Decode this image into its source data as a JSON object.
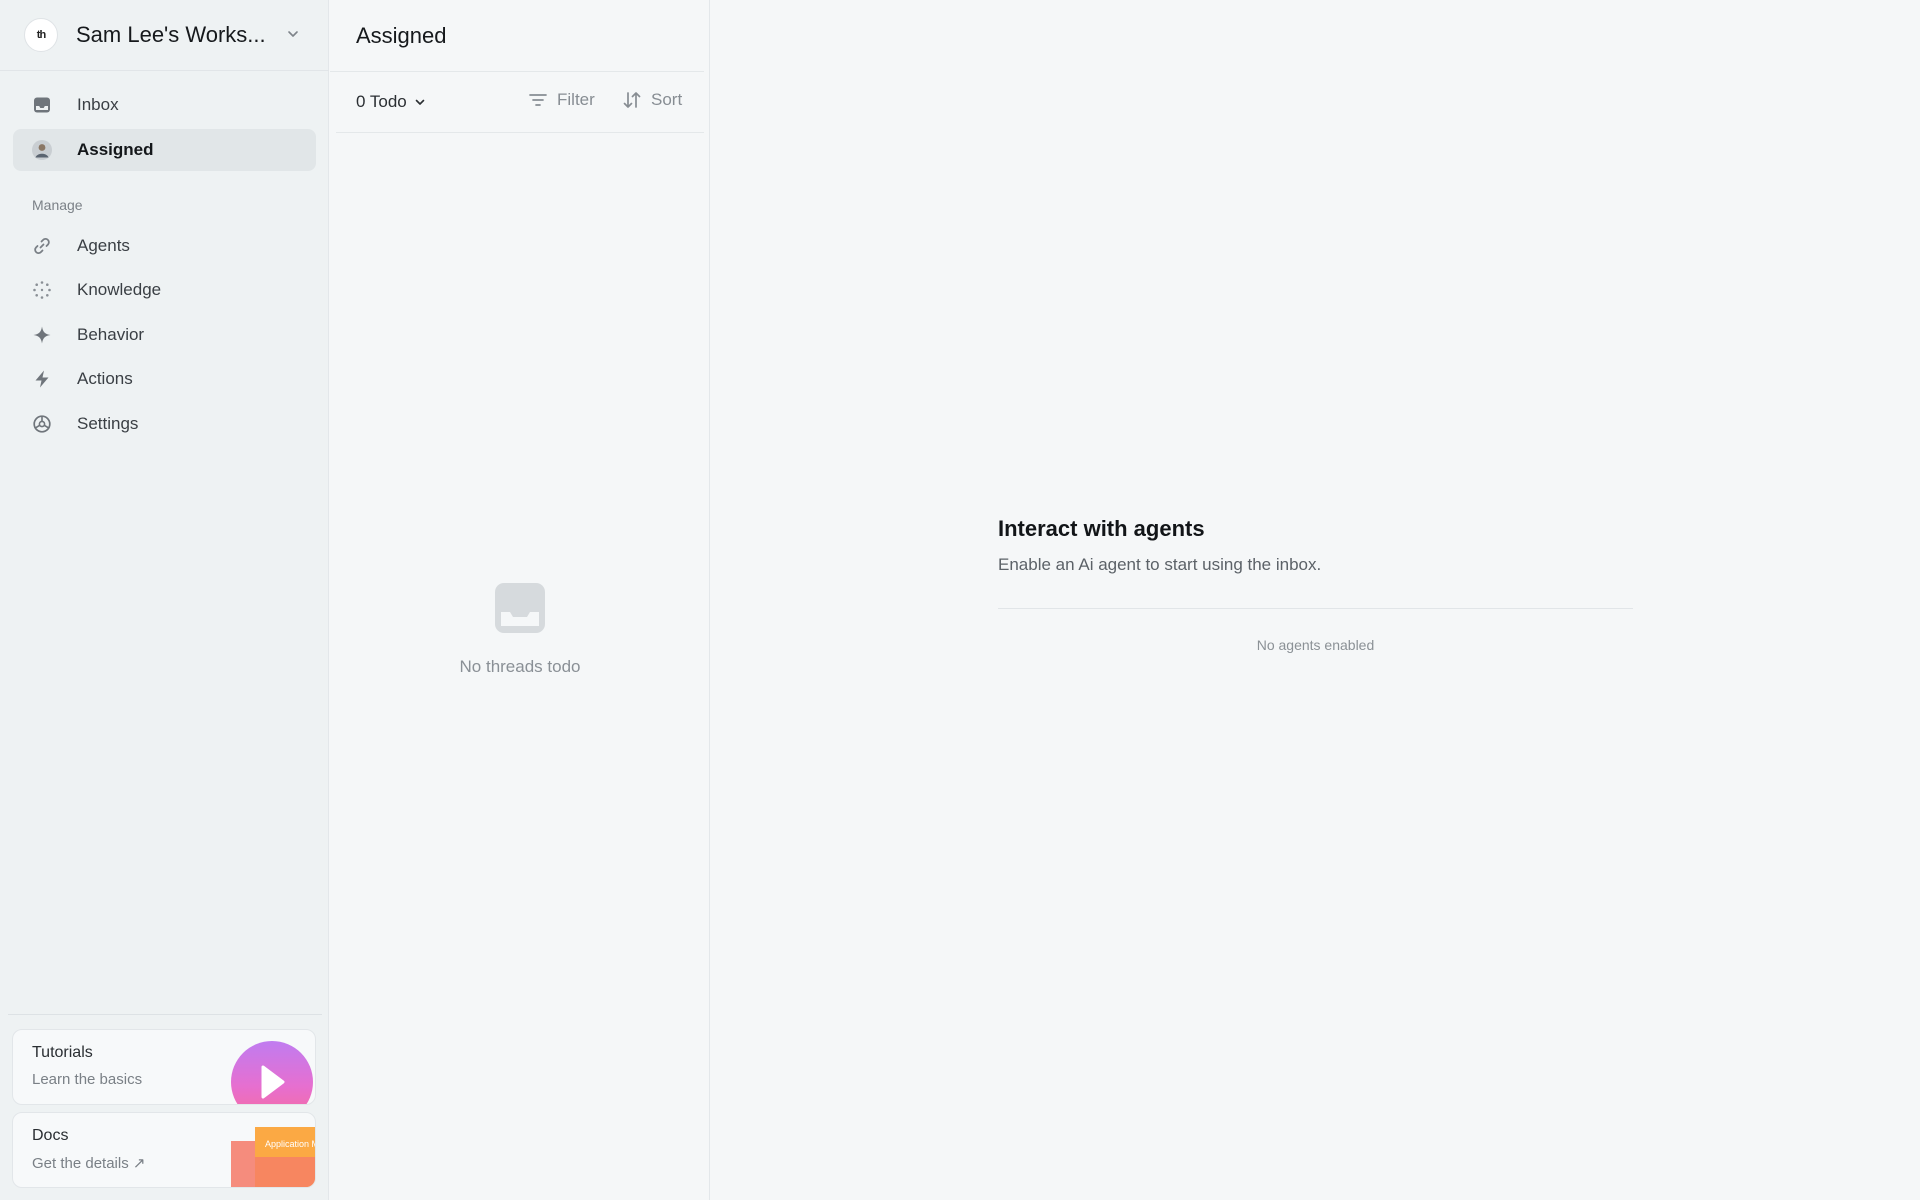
{
  "workspace": {
    "name": "Sam Lee's Works...",
    "logo_text": "th"
  },
  "sidebar": {
    "top_items": [
      {
        "label": "Inbox",
        "icon": "inbox-icon"
      },
      {
        "label": "Assigned",
        "icon": "avatar",
        "active": true
      }
    ],
    "section_label": "Manage",
    "manage_items": [
      {
        "label": "Agents",
        "icon": "link-icon"
      },
      {
        "label": "Knowledge",
        "icon": "dotted-circle-icon"
      },
      {
        "label": "Behavior",
        "icon": "sparkle-icon"
      },
      {
        "label": "Actions",
        "icon": "lightning-icon"
      },
      {
        "label": "Settings",
        "icon": "settings-icon"
      }
    ],
    "tutorials": {
      "title": "Tutorials",
      "subtitle": "Learn the basics"
    },
    "docs": {
      "title": "Docs",
      "subtitle": "Get the details ↗",
      "art_text": "Application Manual"
    }
  },
  "middle": {
    "title": "Assigned",
    "todo_label": "0 Todo",
    "filter_label": "Filter",
    "sort_label": "Sort",
    "empty_text": "No threads todo"
  },
  "main": {
    "title": "Interact with agents",
    "subtitle": "Enable an Ai agent to start using the inbox.",
    "empty_text": "No agents enabled"
  },
  "colors": {
    "sidebar_bg": "#eef2f3",
    "active_item_bg": "#e1e6e8",
    "tutorial_gradient_top": "#c07cf0",
    "tutorial_gradient_bottom": "#f76b9c",
    "docs_orange": "#fba944",
    "docs_coral": "#f4786c"
  }
}
